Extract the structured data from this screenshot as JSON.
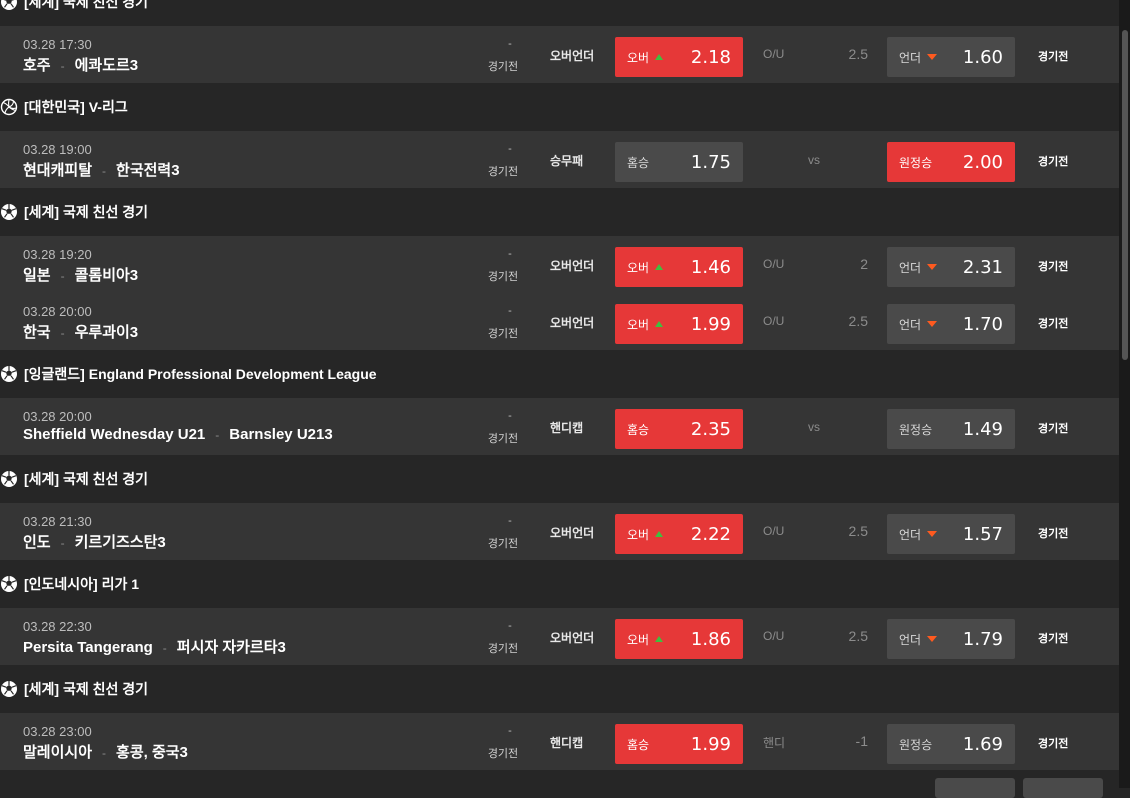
{
  "leagues": [
    {
      "title": "[세계] 국제 친선 경기",
      "sport": "soccer-ball-icon"
    },
    {
      "title": "[대한민국] V-리그",
      "sport": "volleyball-icon"
    },
    {
      "title": "[세계] 국제 친선 경기",
      "sport": "soccer-ball-icon"
    },
    {
      "title": "[잉글랜드] England Professional Development League",
      "sport": "soccer-ball-icon"
    },
    {
      "title": "[세계] 국제 친선 경기",
      "sport": "soccer-ball-icon"
    },
    {
      "title": "[인도네시아] 리가 1",
      "sport": "soccer-ball-icon"
    },
    {
      "title": "[세계] 국제 친선 경기",
      "sport": "soccer-ball-icon"
    }
  ],
  "matches": [
    {
      "time": "03.28 17:30",
      "home": "호주",
      "away": "에콰도르3",
      "dash": "-",
      "status": "경기전",
      "type": "오버언더",
      "home_label": "오버",
      "home_odds": "2.18",
      "mid_label": "O/U",
      "mid_value": "2.5",
      "away_label": "언더",
      "away_odds": "1.60",
      "detail": "경기전"
    },
    {
      "time": "03.28 19:00",
      "home": "현대캐피탈",
      "away": "한국전력3",
      "dash": "-",
      "status": "경기전",
      "type": "승무패",
      "home_label": "홈승",
      "home_odds": "1.75",
      "vs": "vs",
      "away_label": "원정승",
      "away_odds": "2.00",
      "detail": "경기전"
    },
    {
      "time": "03.28 19:20",
      "home": "일본",
      "away": "콜롬비아3",
      "dash": "-",
      "status": "경기전",
      "type": "오버언더",
      "home_label": "오버",
      "home_odds": "1.46",
      "mid_label": "O/U",
      "mid_value": "2",
      "away_label": "언더",
      "away_odds": "2.31",
      "detail": "경기전"
    },
    {
      "time": "03.28 20:00",
      "home": "한국",
      "away": "우루과이3",
      "dash": "-",
      "status": "경기전",
      "type": "오버언더",
      "home_label": "오버",
      "home_odds": "1.99",
      "mid_label": "O/U",
      "mid_value": "2.5",
      "away_label": "언더",
      "away_odds": "1.70",
      "detail": "경기전"
    },
    {
      "time": "03.28 20:00",
      "home": "Sheffield Wednesday U21",
      "away": "Barnsley U213",
      "dash": "-",
      "status": "경기전",
      "type": "핸디캡",
      "home_label": "홈승",
      "home_odds": "2.35",
      "vs": "vs",
      "away_label": "원정승",
      "away_odds": "1.49",
      "detail": "경기전"
    },
    {
      "time": "03.28 21:30",
      "home": "인도",
      "away": "키르기즈스탄3",
      "dash": "-",
      "status": "경기전",
      "type": "오버언더",
      "home_label": "오버",
      "home_odds": "2.22",
      "mid_label": "O/U",
      "mid_value": "2.5",
      "away_label": "언더",
      "away_odds": "1.57",
      "detail": "경기전"
    },
    {
      "time": "03.28 22:30",
      "home": "Persita Tangerang",
      "away": "퍼시자 자카르타3",
      "dash": "-",
      "status": "경기전",
      "type": "오버언더",
      "home_label": "오버",
      "home_odds": "1.86",
      "mid_label": "O/U",
      "mid_value": "2.5",
      "away_label": "언더",
      "away_odds": "1.79",
      "detail": "경기전"
    },
    {
      "time": "03.28 23:00",
      "home": "말레이시아",
      "away": "홍콩, 중국3",
      "dash": "-",
      "status": "경기전",
      "type": "핸디캡",
      "home_label": "홈승",
      "home_odds": "1.99",
      "mid_label": "핸디",
      "mid_value": "-1",
      "away_label": "원정승",
      "away_odds": "1.69",
      "detail": "경기전"
    }
  ],
  "colors": {
    "highlight": "#e63838",
    "up": "#3fbf3f",
    "down": "#ff5a1f"
  }
}
